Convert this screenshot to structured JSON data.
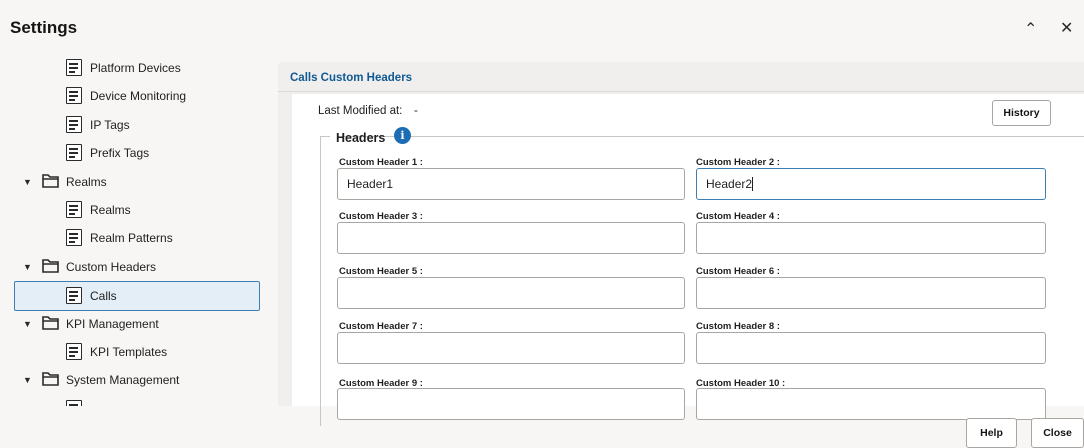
{
  "window": {
    "title": "Settings",
    "collapse_icon": "chevron-up-icon",
    "close_icon": "close-icon"
  },
  "tree": {
    "items": [
      {
        "label": "Platform Devices",
        "type": "document"
      },
      {
        "label": "Device Monitoring",
        "type": "document"
      },
      {
        "label": "IP Tags",
        "type": "document"
      },
      {
        "label": "Prefix Tags",
        "type": "document"
      },
      {
        "label": "Realms",
        "type": "folder",
        "expanded": true
      },
      {
        "label": "Realms",
        "type": "document"
      },
      {
        "label": "Realm Patterns",
        "type": "document"
      },
      {
        "label": "Custom Headers",
        "type": "folder",
        "expanded": true
      },
      {
        "label": "Calls",
        "type": "document",
        "selected": true
      },
      {
        "label": "KPI Management",
        "type": "folder",
        "expanded": true
      },
      {
        "label": "KPI Templates",
        "type": "document"
      },
      {
        "label": "System Management",
        "type": "folder",
        "expanded": true
      }
    ]
  },
  "panel": {
    "title": "Calls Custom Headers",
    "last_modified_label": "Last Modified at:",
    "last_modified_value": "-",
    "history_button": "History",
    "headers_legend": "Headers",
    "info_icon": "info-icon",
    "fields": [
      {
        "label": "Custom Header 1 :",
        "value": "Header1"
      },
      {
        "label": "Custom Header 2 :",
        "value": "Header2",
        "focused": true
      },
      {
        "label": "Custom Header 3 :",
        "value": ""
      },
      {
        "label": "Custom Header 4 :",
        "value": ""
      },
      {
        "label": "Custom Header 5 :",
        "value": ""
      },
      {
        "label": "Custom Header 6 :",
        "value": ""
      },
      {
        "label": "Custom Header 7 :",
        "value": ""
      },
      {
        "label": "Custom Header 8 :",
        "value": ""
      },
      {
        "label": "Custom Header 9 :",
        "value": ""
      },
      {
        "label": "Custom Header 10 :",
        "value": ""
      }
    ]
  },
  "footer": {
    "help_button": "Help",
    "close_button": "Close"
  },
  "colors": {
    "accent": "#0f5a93",
    "selection_bg": "#e4eef6",
    "selection_border": "#3e7fb3",
    "info_icon": "#1d6db5"
  }
}
